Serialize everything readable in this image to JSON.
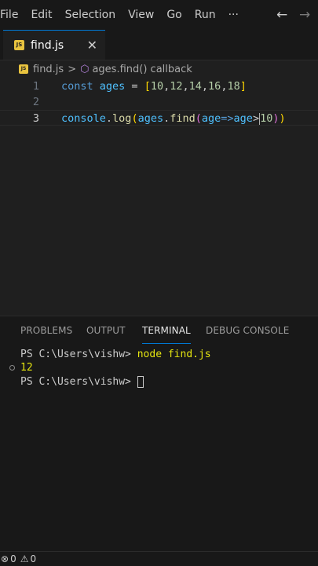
{
  "menu": {
    "items": [
      "File",
      "Edit",
      "Selection",
      "View",
      "Go",
      "Run",
      "···"
    ],
    "back_icon": "arrow-left-icon",
    "forward_icon": "arrow-right-icon",
    "back_glyph": "←",
    "forward_glyph": "→"
  },
  "tab": {
    "badge": "JS",
    "label": "find.js",
    "close_glyph": "✕"
  },
  "breadcrumb": {
    "file": "find.js",
    "separator": ">",
    "symbol_glyph": "⬡",
    "symbol": "ages.find() callback"
  },
  "editor": {
    "lines": [
      {
        "number": "1",
        "tokens": [
          {
            "t": "const",
            "c": "kw"
          },
          {
            "t": " ",
            "c": "pl"
          },
          {
            "t": "ages",
            "c": "vr"
          },
          {
            "t": " = ",
            "c": "pl"
          },
          {
            "t": "[",
            "c": "br1"
          },
          {
            "t": "10",
            "c": "nm"
          },
          {
            "t": ",",
            "c": "pl"
          },
          {
            "t": "12",
            "c": "nm"
          },
          {
            "t": ",",
            "c": "pl"
          },
          {
            "t": "14",
            "c": "nm"
          },
          {
            "t": ",",
            "c": "pl"
          },
          {
            "t": "16",
            "c": "nm"
          },
          {
            "t": ",",
            "c": "pl"
          },
          {
            "t": "18",
            "c": "nm"
          },
          {
            "t": "]",
            "c": "br1"
          }
        ]
      },
      {
        "number": "2",
        "tokens": []
      },
      {
        "number": "3",
        "tokens": [
          {
            "t": "console",
            "c": "vr"
          },
          {
            "t": ".",
            "c": "pl"
          },
          {
            "t": "log",
            "c": "fn"
          },
          {
            "t": "(",
            "c": "br1"
          },
          {
            "t": "ages",
            "c": "vr"
          },
          {
            "t": ".",
            "c": "pl"
          },
          {
            "t": "find",
            "c": "fn"
          },
          {
            "t": "(",
            "c": "br2"
          },
          {
            "t": "age",
            "c": "vr"
          },
          {
            "t": "=>",
            "c": "kw"
          },
          {
            "t": "age",
            "c": "vr"
          },
          {
            "t": ">",
            "c": "pl"
          },
          {
            "t": "|",
            "c": "caret"
          },
          {
            "t": "10",
            "c": "nm"
          },
          {
            "t": ")",
            "c": "br2"
          },
          {
            "t": ")",
            "c": "br1"
          }
        ]
      }
    ]
  },
  "panel": {
    "tabs": [
      "PROBLEMS",
      "OUTPUT",
      "TERMINAL",
      "DEBUG CONSOLE"
    ],
    "active_tab": "TERMINAL"
  },
  "terminal": {
    "prompt": "PS C:\\Users\\vishw> ",
    "command": "node find.js",
    "output": "12",
    "prompt2": "PS C:\\Users\\vishw> "
  },
  "status": {
    "error_glyph": "⊗",
    "errors": "0",
    "warning_glyph": "⚠",
    "warnings": "0"
  }
}
